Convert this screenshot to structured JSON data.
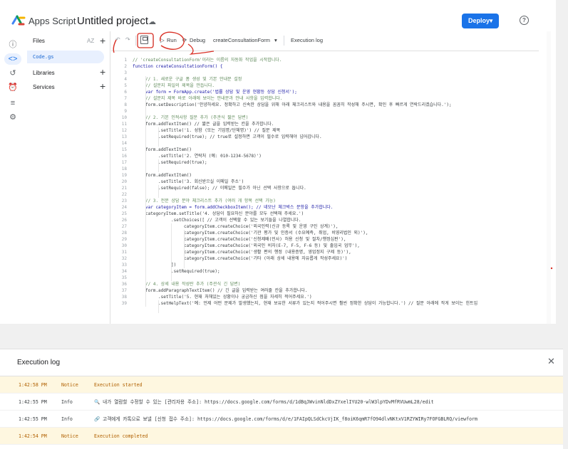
{
  "header": {
    "app_name": "Apps Script",
    "project_title": "Untitled project",
    "deploy_label": "Deploy",
    "help": "?"
  },
  "files_panel": {
    "files_label": "Files",
    "sort_label": "AZ",
    "file_name": "Code.gs",
    "libraries_label": "Libraries",
    "services_label": "Services"
  },
  "toolbar": {
    "run_label": "Run",
    "debug_label": "Debug",
    "function_name": "createConsultationForm",
    "exec_log_label": "Execution log"
  },
  "code_lines": [
    {
      "n": "1",
      "t": "// 'createConsultationForm'이라는 이름의 자동화 작업을 시작합니다.",
      "k": "comment",
      "i": 0
    },
    {
      "n": "2",
      "t": "function createConsultationForm() {",
      "k": "keyword",
      "i": 0
    },
    {
      "n": "3",
      "t": "",
      "k": "",
      "i": 0
    },
    {
      "n": "4",
      "t": "// 1. 새로운 구글 폼 생성 및 기본 안내문 설정",
      "k": "comment",
      "i": 1
    },
    {
      "n": "5",
      "t": "// 설문지 파일의 제목을 만듭니다.",
      "k": "comment",
      "i": 1
    },
    {
      "n": "6",
      "t": "var form = FormApp.create('법률 상담 및 운영 현황등 상담 신청서');",
      "k": "keyword",
      "i": 1
    },
    {
      "n": "7",
      "t": "// 설문지 제목 바로 아래에 보이는 안내문과 안내 사항을 입력합니다.",
      "k": "comment",
      "i": 1
    },
    {
      "n": "8",
      "t": "form.setDescription('안녕하세요. 정확하고 신속한 상담을 위해 아래 체크리스트와 내용을 꼼꼼히 작성해 주시면, 확인 후 빠르게 연락드리겠습니다.');",
      "k": "",
      "i": 1
    },
    {
      "n": "9",
      "t": "",
      "k": "",
      "i": 0
    },
    {
      "n": "10",
      "t": "// 2. 기본 인적사항 질문 추가 (주관식 짧은 답변)",
      "k": "comment",
      "i": 1
    },
    {
      "n": "11",
      "t": "form.addTextItem() // 짧은 글을 입력받는 칸을 추가합니다.",
      "k": "",
      "i": 1
    },
    {
      "n": "12",
      "t": ".setTitle('1. 성함 (또는 기업명/단체명)') // 질문 제목",
      "k": "",
      "i": 2
    },
    {
      "n": "13",
      "t": ".setRequired(true); // true로 설정하면 고객이 필수로 입력해야 넘어갑니다.",
      "k": "",
      "i": 2
    },
    {
      "n": "14",
      "t": "",
      "k": "",
      "i": 0
    },
    {
      "n": "15",
      "t": "form.addTextItem()",
      "k": "",
      "i": 1
    },
    {
      "n": "16",
      "t": ".setTitle('2. 연락처 (예: 010-1234-5678)')",
      "k": "",
      "i": 2
    },
    {
      "n": "17",
      "t": ".setRequired(true);",
      "k": "",
      "i": 2
    },
    {
      "n": "18",
      "t": "",
      "k": "",
      "i": 0
    },
    {
      "n": "19",
      "t": "form.addTextItem()",
      "k": "",
      "i": 1
    },
    {
      "n": "20",
      "t": ".setTitle('3. 회신받으실 이메일 주소')",
      "k": "",
      "i": 2
    },
    {
      "n": "21",
      "t": ".setRequired(false); // 이메일은 필수가 아닌 선택 사항으로 둡니다.",
      "k": "",
      "i": 2
    },
    {
      "n": "22",
      "t": "",
      "k": "",
      "i": 0
    },
    {
      "n": "23",
      "t": "// 3. 전문 상담 분야 체크리스트 추가 (여러 개 항목 선택 가능)",
      "k": "comment",
      "i": 1
    },
    {
      "n": "24",
      "t": "var categoryItem = form.addCheckboxItem(); // 네모난 체크박스 문항을 추가합니다.",
      "k": "keyword",
      "i": 1
    },
    {
      "n": "25",
      "t": "categoryItem.setTitle('4. 상담이 필요하신 분야를 모두 선택해 주세요.')",
      "k": "",
      "i": 1
    },
    {
      "n": "26",
      "t": ".setChoices([ // 고객이 선택할 수 있는 보기들을 나열합니다.",
      "k": "",
      "i": 3
    },
    {
      "n": "27",
      "t": "categoryItem.createChoice('외국인력(신규 등록 및 운영 구인 상계)'),",
      "k": "",
      "i": 4
    },
    {
      "n": "28",
      "t": "categoryItem.createChoice('기관 평가 및 인증서 (수요예측, 취업, 비영리법인 외)'),",
      "k": "",
      "i": 4
    },
    {
      "n": "29",
      "t": "categoryItem.createChoice('신청제배(민사) 허용 신청 및 절차/행정심판'),",
      "k": "",
      "i": 4
    },
    {
      "n": "30",
      "t": "categoryItem.createChoice('외국인 비자(E-7, F-5, F-6 등) 및 출입국 업무'),",
      "k": "",
      "i": 4
    },
    {
      "n": "31",
      "t": "categoryItem.createChoice('생활 편의 행정 (내용증명, 영업정지 구제 등)'),",
      "k": "",
      "i": 4
    },
    {
      "n": "32",
      "t": "categoryItem.createChoice('기타 (아래 상세 내용에 자유롭게 작성주세요)')",
      "k": "",
      "i": 4
    },
    {
      "n": "33",
      "t": "])",
      "k": "",
      "i": 3
    },
    {
      "n": "34",
      "t": ".setRequired(true);",
      "k": "",
      "i": 3
    },
    {
      "n": "35",
      "t": "",
      "k": "",
      "i": 0
    },
    {
      "n": "36",
      "t": "// 4. 상세 내용 작성란 추가 (주관식 긴 답변)",
      "k": "comment",
      "i": 1
    },
    {
      "n": "37",
      "t": "form.addParagraphTextItem() // 긴 글을 입력받는 여러줄 칸을 추가합니다.",
      "k": "",
      "i": 1
    },
    {
      "n": "38",
      "t": ".setTitle('5. 현재 처해있는 상황이나 궁금하신 점을 자세히 적어주세요.')",
      "k": "",
      "i": 2
    },
    {
      "n": "39",
      "t": ".setHelpText('예: 언제 어떤 문제가 발생했는지, 현재 보유한 서류가 있는지 적어주시면 훨씬 정확한 상담이 가능합니다.') // 질문 아래에 작게 보이는 힌트입",
      "k": "",
      "i": 2
    }
  ],
  "execution_log": {
    "title": "Execution log",
    "close": "✕",
    "rows": [
      {
        "time": "1:42:58 PM",
        "level": "Notice",
        "msg": "Execution started",
        "hl": true
      },
      {
        "time": "1:42:55 PM",
        "level": "Info",
        "msg": "🔍 내가 열람할 수정할 수 있는 [관리자용 주소]: https://docs.google.com/forms/d/1dBqJWvinNldDxZYxelIYU20-wlW3lpYDvMfRVUwmL28/edit",
        "hl": false
      },
      {
        "time": "1:42:55 PM",
        "level": "Info",
        "msg": "🔗 고객에게 카톡으로 보낼 [신청 접수 주소]: https://docs.google.com/forms/d/e/1FAIpQLSdCkcVjIK_f8oiK6qmR7fO94dlvNKtxV1RZYWIRy7FOFGBLRQ/viewform",
        "hl": false
      },
      {
        "time": "1:42:54 PM",
        "level": "Notice",
        "msg": "Execution completed",
        "hl": true
      }
    ]
  },
  "colors": {
    "accent": "#1a73e8",
    "annotation": "#d93025",
    "log_highlight": "#fef7e0"
  },
  "icons": [
    "info-icon",
    "code-icon",
    "history-icon",
    "alarm-icon",
    "executions-icon",
    "settings-icon",
    "cloud-icon",
    "undo-icon",
    "redo-icon",
    "save-icon",
    "play-icon",
    "debug-icon",
    "close-icon"
  ]
}
